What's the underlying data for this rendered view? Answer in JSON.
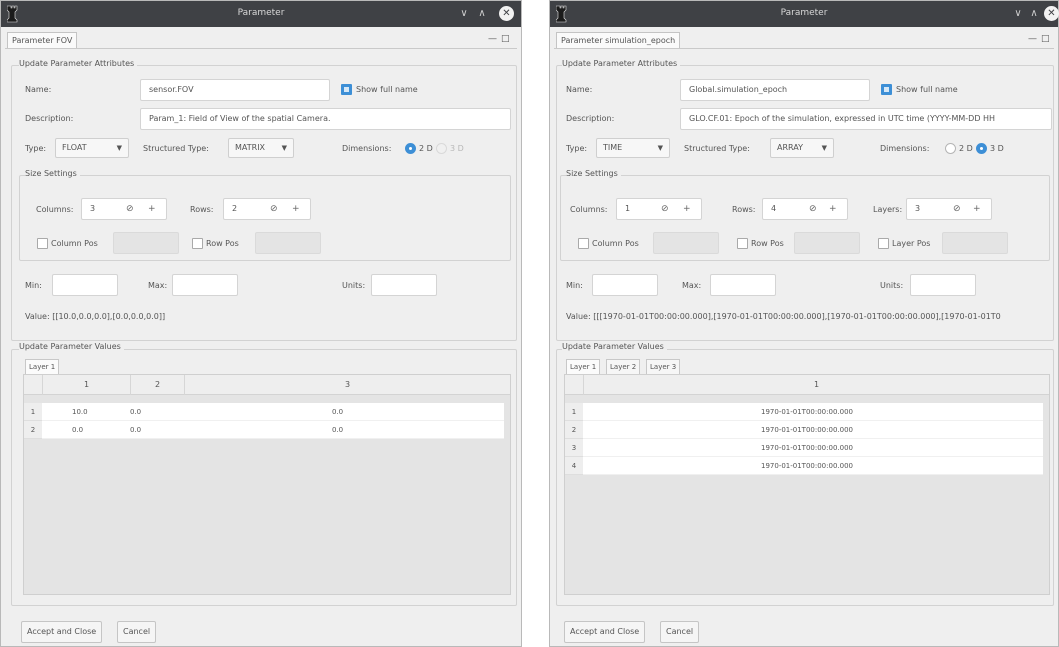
{
  "left": {
    "window_title": "Parameter",
    "doc_tab": "Parameter FOV",
    "attributes_group": "Update Parameter Attributes",
    "name_label": "Name:",
    "name_value": "sensor.FOV",
    "show_full_name": "Show full name",
    "description_label": "Description:",
    "description_value": "Param_1: Field of View of the spatial Camera.",
    "type_label": "Type:",
    "type_value": "FLOAT",
    "structured_type_label": "Structured Type:",
    "structured_type_value": "MATRIX",
    "dimensions_label": "Dimensions:",
    "dim_2d": "2 D",
    "dim_3d": "3 D",
    "size_group": "Size Settings",
    "columns_label": "Columns:",
    "columns_value": "3",
    "rows_label": "Rows:",
    "rows_value": "2",
    "column_pos": "Column Pos",
    "row_pos": "Row Pos",
    "min_label": "Min:",
    "max_label": "Max:",
    "units_label": "Units:",
    "value_text": "Value: [[10.0,0.0,0.0],[0.0,0.0,0.0]]",
    "values_group": "Update Parameter Values",
    "tabs": [
      "Layer 1"
    ],
    "columns": [
      "1",
      "2",
      "3"
    ],
    "rows": [
      {
        "index": "1",
        "cells": [
          "10.0",
          "0.0",
          "0.0"
        ]
      },
      {
        "index": "2",
        "cells": [
          "0.0",
          "0.0",
          "0.0"
        ]
      }
    ],
    "accept_button": "Accept and Close",
    "cancel_button": "Cancel"
  },
  "right": {
    "window_title": "Parameter",
    "doc_tab": "Parameter simulation_epoch",
    "attributes_group": "Update Parameter Attributes",
    "name_label": "Name:",
    "name_value": "Global.simulation_epoch",
    "show_full_name": "Show full name",
    "description_label": "Description:",
    "description_value": "GLO.CF.01: Epoch of the simulation, expressed in UTC time (YYYY-MM-DD HH",
    "type_label": "Type:",
    "type_value": "TIME",
    "structured_type_label": "Structured Type:",
    "structured_type_value": "ARRAY",
    "dimensions_label": "Dimensions:",
    "dim_2d": "2 D",
    "dim_3d": "3 D",
    "size_group": "Size Settings",
    "columns_label": "Columns:",
    "columns_value": "1",
    "rows_label": "Rows:",
    "rows_value": "4",
    "layers_label": "Layers:",
    "layers_value": "3",
    "column_pos": "Column Pos",
    "row_pos": "Row Pos",
    "layer_pos": "Layer Pos",
    "min_label": "Min:",
    "max_label": "Max:",
    "units_label": "Units:",
    "value_text": "Value: [[[1970-01-01T00:00:00.000],[1970-01-01T00:00:00.000],[1970-01-01T00:00:00.000],[1970-01-01T0",
    "values_group": "Update Parameter Values",
    "tabs": [
      "Layer 1",
      "Layer 2",
      "Layer 3"
    ],
    "columns": [
      "1"
    ],
    "rows": [
      {
        "index": "1",
        "cells": [
          "1970-01-01T00:00:00.000"
        ]
      },
      {
        "index": "2",
        "cells": [
          "1970-01-01T00:00:00.000"
        ]
      },
      {
        "index": "3",
        "cells": [
          "1970-01-01T00:00:00.000"
        ]
      },
      {
        "index": "4",
        "cells": [
          "1970-01-01T00:00:00.000"
        ]
      }
    ],
    "accept_button": "Accept and Close",
    "cancel_button": "Cancel"
  },
  "icons": {
    "app": "chess-rook-icon",
    "minimize": "chevron-down-icon",
    "maximize": "chevron-up-icon",
    "close": "close-icon",
    "reset": "reset-icon",
    "plus": "plus-icon"
  },
  "colors": {
    "titlebar": "#3f4145",
    "accent": "#3d8fd6",
    "window_bg": "#efefef"
  }
}
